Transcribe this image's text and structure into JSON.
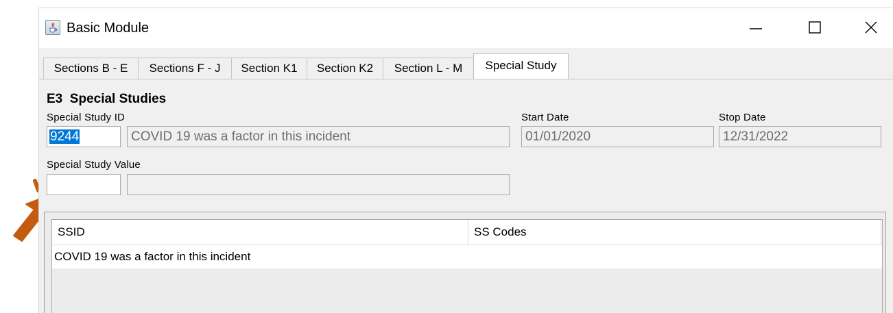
{
  "window": {
    "title": "Basic Module",
    "icon": "java-cup-icon",
    "controls": [
      "minimize-icon",
      "maximize-icon",
      "close-icon"
    ]
  },
  "tabs": [
    {
      "label": "Sections B - E",
      "active": false
    },
    {
      "label": "Sections F - J",
      "active": false
    },
    {
      "label": "Section K1",
      "active": false
    },
    {
      "label": "Section K2",
      "active": false
    },
    {
      "label": "Section L - M",
      "active": false
    },
    {
      "label": "Special Study",
      "active": true
    }
  ],
  "section": {
    "title": "E3  Special Studies",
    "special_study_id": {
      "label": "Special Study ID",
      "value": "9244",
      "description": "COVID 19 was a factor in this incident"
    },
    "start_date": {
      "label": "Start Date",
      "value": "01/01/2020"
    },
    "stop_date": {
      "label": "Stop Date",
      "value": "12/31/2022"
    },
    "special_study_value": {
      "label": "Special Study Value",
      "value": "",
      "description": ""
    }
  },
  "grid": {
    "columns": [
      "SSID",
      "SS Codes"
    ],
    "rows": [
      [
        "COVID 19 was a factor in this incident",
        ""
      ]
    ]
  },
  "annotation": {
    "icon": "click-pointer-icon",
    "color": "#c55a11"
  },
  "colors": {
    "selection": "#0078d7",
    "window_bg": "#f0f0f0"
  }
}
